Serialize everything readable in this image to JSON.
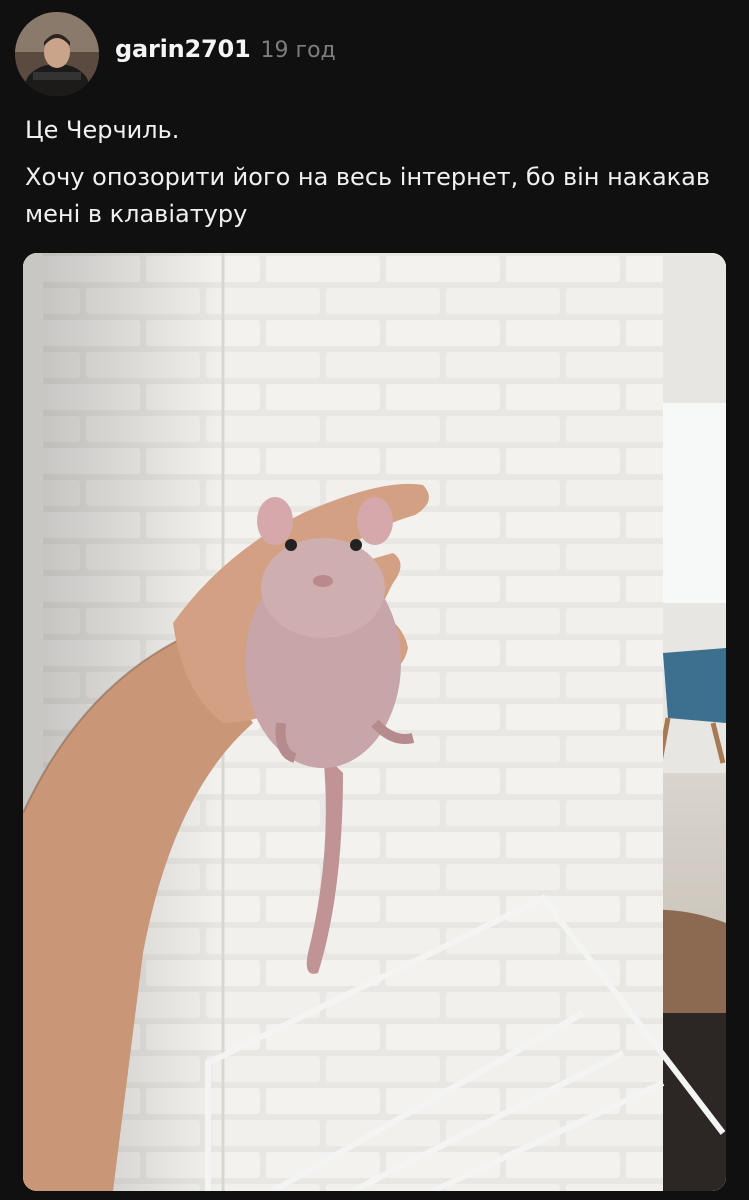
{
  "post": {
    "username": "garin2701",
    "time": "19 год",
    "caption_lines": [
      "Це Черчиль.",
      "Хочу опозорити його на весь інтернет, бо він накакав мені в клавіатуру"
    ]
  },
  "icons": {
    "avatar": "user-avatar-photo",
    "media": "photo-hairless-rat-held-in-hand"
  }
}
